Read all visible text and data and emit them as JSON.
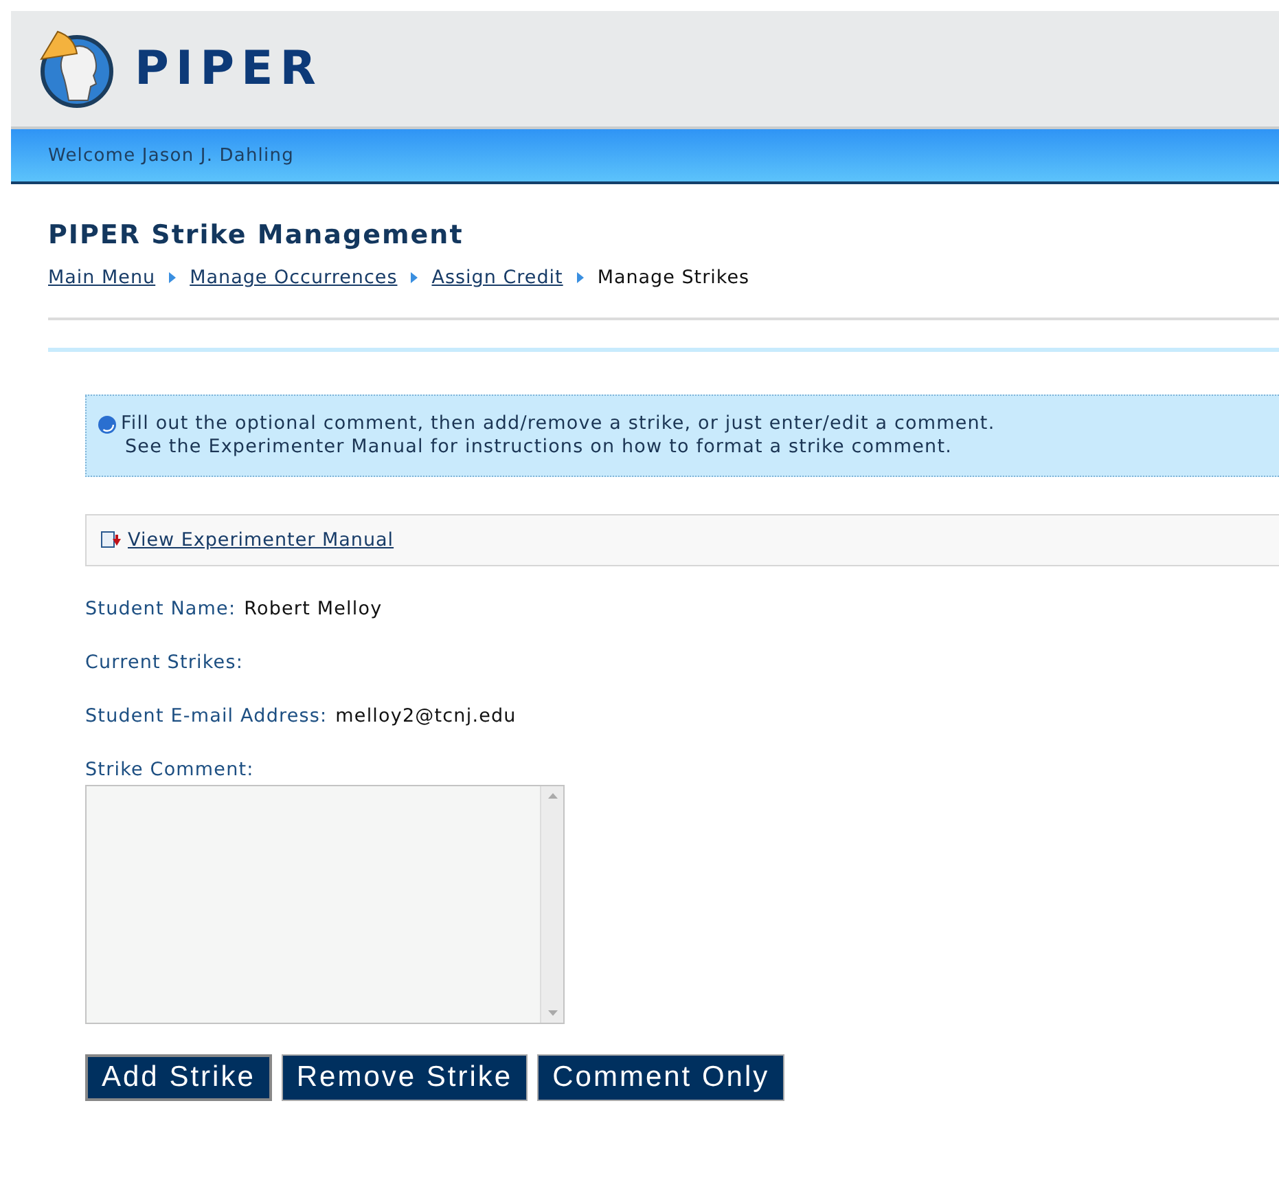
{
  "header": {
    "logo_text": "PIPER"
  },
  "welcome": "Welcome Jason J. Dahling",
  "page_title": "PIPER Strike Management",
  "breadcrumb": [
    {
      "label": "Main Menu",
      "link": true
    },
    {
      "label": "Manage Occurrences",
      "link": true
    },
    {
      "label": "Assign Credit",
      "link": true
    },
    {
      "label": "Manage Strikes",
      "link": false
    }
  ],
  "info": {
    "lines": [
      "Fill out the optional comment, then add/remove a strike, or just enter/edit a comment.",
      "See the Experimenter Manual for instructions on how to format a strike comment."
    ]
  },
  "manual_link": "View Experimenter Manual",
  "fields": [
    {
      "label": "Student Name:",
      "value": "Robert Melloy"
    },
    {
      "label": "Current Strikes:"
    },
    {
      "label": "Student E-mail Address:",
      "value": "melloy2@tcnj.edu"
    }
  ],
  "comment": {
    "label": "Strike Comment:"
  },
  "buttons": [
    {
      "label": "Add Strike",
      "focused": true
    },
    {
      "label": "Remove Strike",
      "focused": false
    },
    {
      "label": "Comment Only",
      "focused": false
    }
  ]
}
